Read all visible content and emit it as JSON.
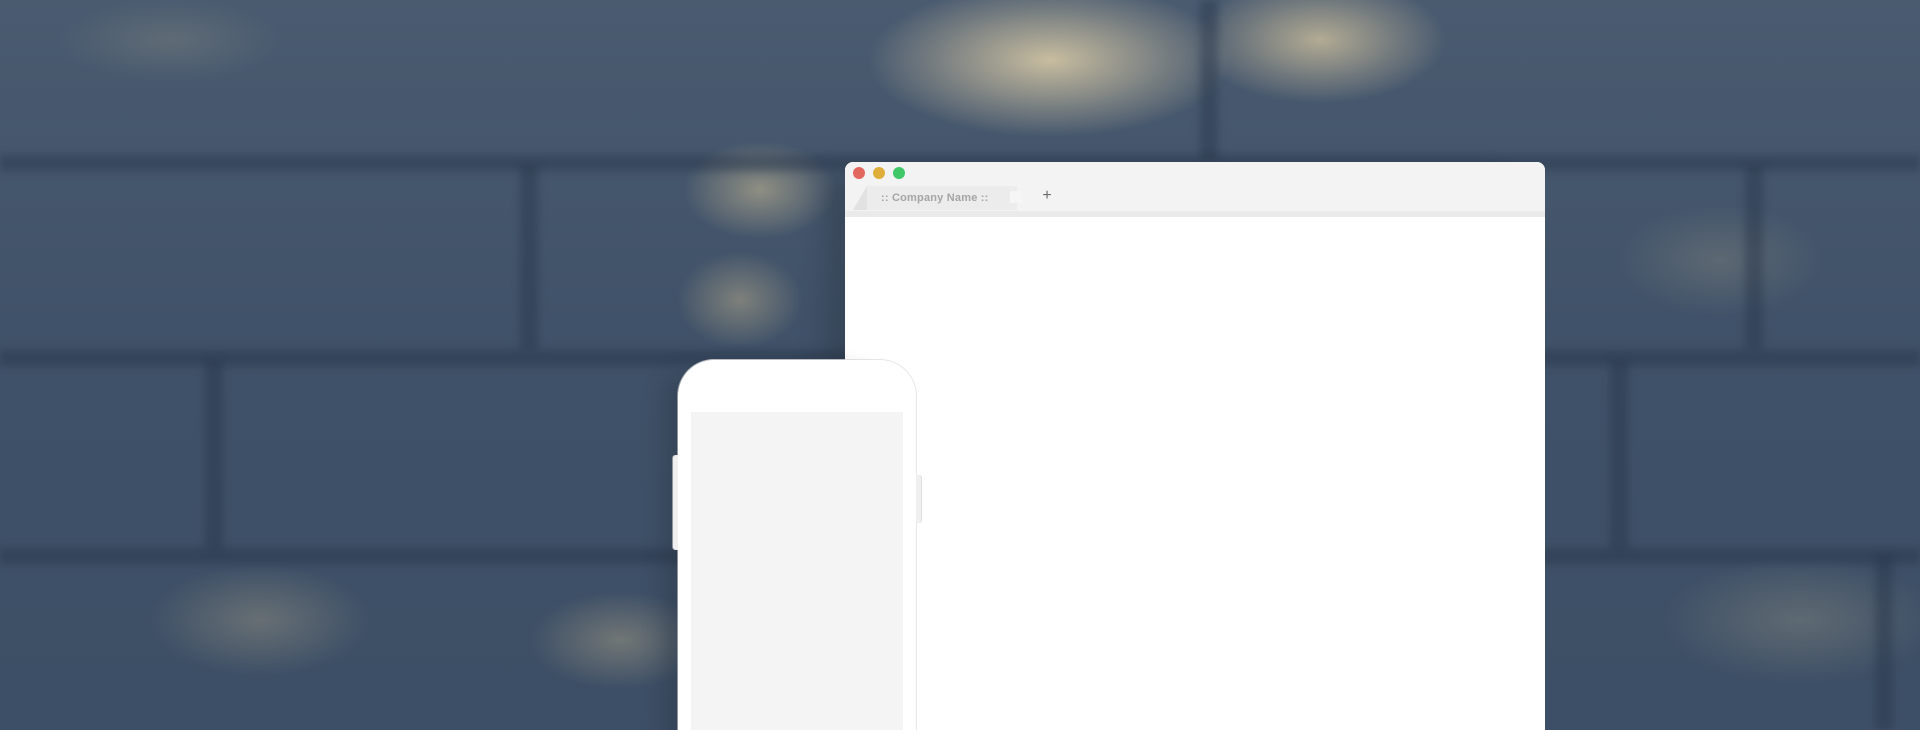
{
  "browser": {
    "tab": {
      "label": ":: Company Name ::"
    },
    "new_tab_label": "+",
    "controls": {
      "close_color": "#e2685f",
      "minimize_color": "#dfae3a",
      "maximize_color": "#3fc768"
    }
  },
  "background": {
    "description_color": "#40536a"
  },
  "icons": {
    "new_tab": "plus-icon"
  }
}
